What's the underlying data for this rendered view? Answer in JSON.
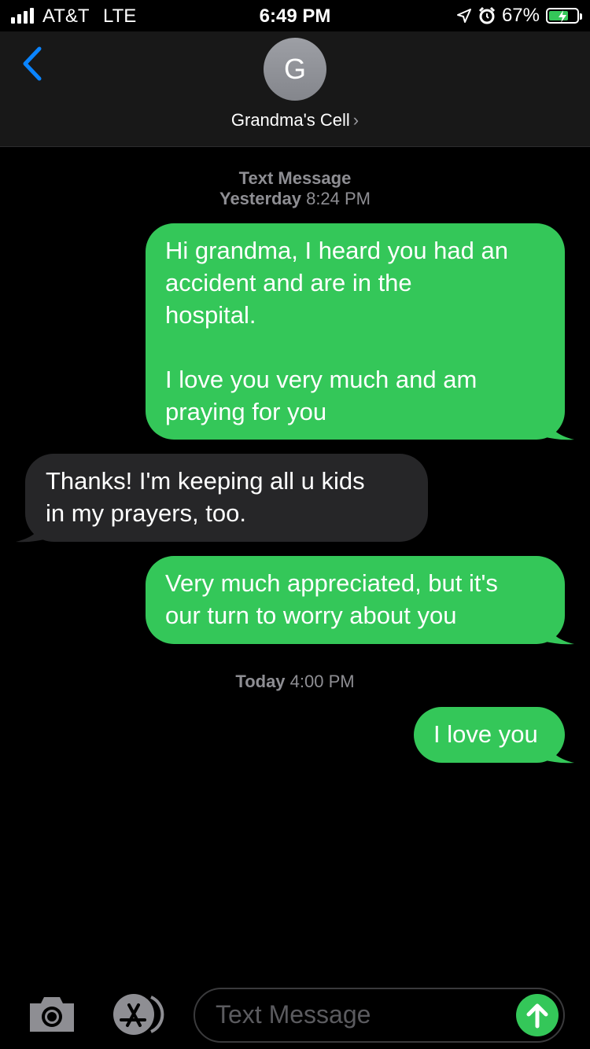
{
  "status_bar": {
    "carrier": "AT&T",
    "network": "LTE",
    "time": "6:49 PM",
    "battery": "67%",
    "battery_level": 0.67
  },
  "header": {
    "avatar_initial": "G",
    "contact_name": "Grandma's Cell",
    "chevron": "›",
    "icons": [
      "back-chevron-icon"
    ]
  },
  "thread": {
    "service_label": "Text Message",
    "first_day": "Yesterday",
    "first_time": "8:24 PM",
    "second_day": "Today",
    "second_time": "4:00 PM",
    "messages": [
      {
        "direction": "sent",
        "lines": [
          "Hi grandma, I heard you had an",
          "accident and are in the",
          "hospital.",
          "",
          "I love you very much and am",
          "praying for you"
        ]
      },
      {
        "direction": "received",
        "lines": [
          "Thanks!  I'm keeping all u kids",
          "in my prayers, too."
        ]
      },
      {
        "direction": "sent",
        "lines": [
          "Very much appreciated, but it's",
          "our turn to worry about you"
        ]
      },
      {
        "direction": "sent",
        "lines": [
          "I love you"
        ]
      }
    ]
  },
  "input_bar": {
    "placeholder": "Text Message",
    "icons": [
      "camera-icon",
      "app-store-icon",
      "send-arrow-icon"
    ]
  },
  "colors": {
    "sent_bubble": "#34c759",
    "received_bubble": "#262628",
    "accent_blue": "#0a84ff",
    "background": "#000000"
  }
}
